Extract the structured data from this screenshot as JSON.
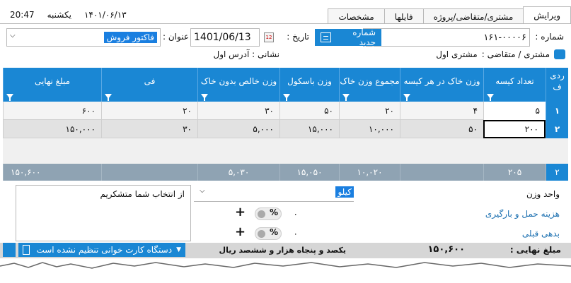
{
  "tabs": [
    "ویرایش",
    "مشتری/متقاضی/پروژه",
    "فایلها",
    "مشخصات"
  ],
  "clock": {
    "time": "20:47",
    "day": "یکشنبه",
    "date": "۱۴۰۱/۰۶/۱۳"
  },
  "header": {
    "number_label": "شماره :",
    "number_value": "۱۶۱-۰۰۰۰۶",
    "new_number_button": "شماره جدید",
    "date_label": "تاریخ :",
    "date_value": "1401/06/13",
    "title_label": "عنوان :",
    "title_value": "فاکتور فروش",
    "customer_label": "مشتری / متقاضی :",
    "customer_value": "مشتری اول",
    "address_label": "نشانی : آدرس اول"
  },
  "table": {
    "columns": [
      "ردی ف",
      "تعداد کیسه",
      "وزن خاک در هر کیسه",
      "مجموع وزن خاک",
      "وزن باسکول",
      "وزن خالص بدون خاک",
      "فی",
      "مبلغ نهایی"
    ],
    "rows": [
      {
        "row": "۱",
        "bags": "۵",
        "soil_per_bag": "۴",
        "soil_total": "۲۰",
        "scale": "۵۰",
        "net": "۳۰",
        "fee": "۲۰",
        "final": "۶۰۰"
      },
      {
        "row": "۲",
        "bags": "۲۰۰",
        "soil_per_bag": "۵۰",
        "soil_total": "۱۰,۰۰۰",
        "scale": "۱۵,۰۰۰",
        "net": "۵,۰۰۰",
        "fee": "۳۰",
        "final": "۱۵۰,۰۰۰"
      }
    ],
    "totals": {
      "row": "۲",
      "bags": "۲۰۵",
      "soil_per_bag": "",
      "soil_total": "۱۰,۰۲۰",
      "scale": "۱۵,۰۵۰",
      "net": "۵,۰۳۰",
      "fee": "",
      "final": "۱۵۰,۶۰۰"
    }
  },
  "bottom": {
    "weight_unit_label": "واحد وزن",
    "weight_unit_value": "کیلو",
    "shipping_label": "هزینه حمل و بارگیری",
    "prev_debt_label": "بدهی قبلی",
    "shipping_value": "۰",
    "prev_debt_value": "۰",
    "percent": "%",
    "memo": "از انتخاب شما متشکریم",
    "final_amount_label": "مبلغ نهایی :",
    "final_amount_value": "۱۵۰,۶۰۰",
    "amount_words": "یکصد و پنجاه  هزار و ششصد ریال",
    "card_reader_status": "دستگاه کارت خوانی تنظیم نشده است"
  }
}
